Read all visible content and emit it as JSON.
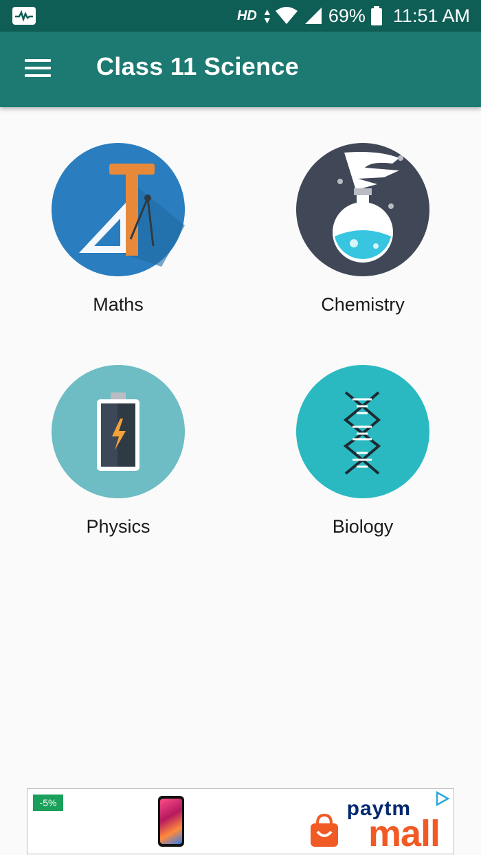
{
  "status_bar": {
    "network": "HD",
    "battery": "69%",
    "time": "11:51 AM"
  },
  "app_bar": {
    "title": "Class 11 Science",
    "menu_icon": "hamburger-menu-icon"
  },
  "subjects": [
    {
      "label": "Maths",
      "icon": "maths-ruler-compass-icon",
      "color": "#2a7dbe"
    },
    {
      "label": "Chemistry",
      "icon": "chemistry-flask-icon",
      "color": "#404857"
    },
    {
      "label": "Physics",
      "icon": "physics-battery-icon",
      "color": "#6ebcc4"
    },
    {
      "label": "Biology",
      "icon": "biology-dna-icon",
      "color": "#2ab9c1"
    }
  ],
  "ad": {
    "discount": "-5%",
    "brand_top": "paytm",
    "brand_main": "mall"
  },
  "colors": {
    "status_bar": "#0f5e56",
    "app_bar": "#1c7a72",
    "background": "#fafafa"
  }
}
